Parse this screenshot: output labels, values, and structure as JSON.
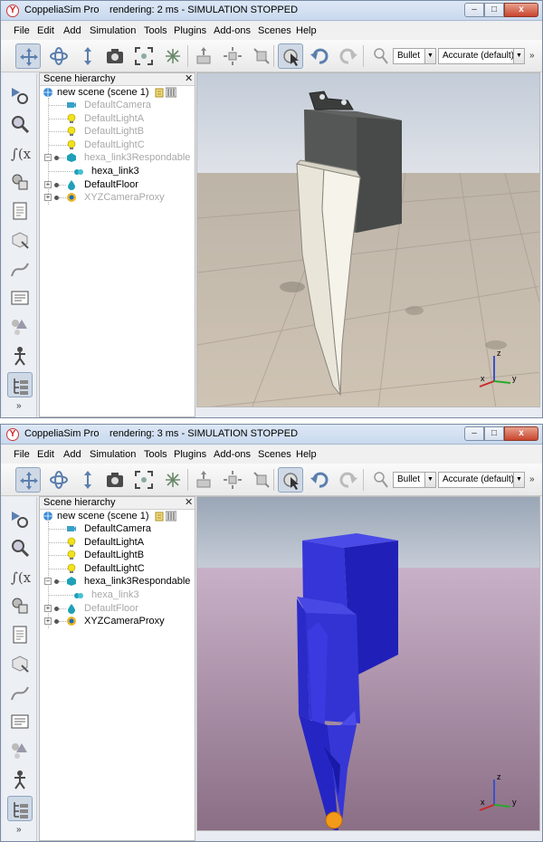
{
  "windows": [
    {
      "app_title": "CoppeliaSim Pro",
      "status": "rendering: 2 ms - SIMULATION STOPPED",
      "toolbar": {
        "physics_engine": "Bullet",
        "accuracy": "Accurate (default)"
      },
      "hierarchy": {
        "title": "Scene hierarchy",
        "scene": "new scene (scene 1)",
        "items": [
          {
            "label": "DefaultCamera",
            "dimmed": true
          },
          {
            "label": "DefaultLightA",
            "dimmed": true
          },
          {
            "label": "DefaultLightB",
            "dimmed": true
          },
          {
            "label": "DefaultLightC",
            "dimmed": true
          },
          {
            "label": "hexa_link3Respondable",
            "dimmed": true
          },
          {
            "label": "hexa_link3",
            "dimmed": false
          },
          {
            "label": "DefaultFloor",
            "dimmed": false
          },
          {
            "label": "XYZCameraProxy",
            "dimmed": true
          }
        ]
      },
      "viewport": {
        "theme": "textured-floor",
        "object_color": "#f2efe6"
      },
      "axes": {
        "x": "x",
        "y": "y",
        "z": "z"
      }
    },
    {
      "app_title": "CoppeliaSim Pro",
      "status": "rendering: 3 ms - SIMULATION STOPPED",
      "toolbar": {
        "physics_engine": "Bullet",
        "accuracy": "Accurate (default)"
      },
      "hierarchy": {
        "title": "Scene hierarchy",
        "scene": "new scene (scene 1)",
        "items": [
          {
            "label": "DefaultCamera",
            "dimmed": false
          },
          {
            "label": "DefaultLightA",
            "dimmed": false
          },
          {
            "label": "DefaultLightB",
            "dimmed": false
          },
          {
            "label": "DefaultLightC",
            "dimmed": false
          },
          {
            "label": "hexa_link3Respondable",
            "dimmed": false
          },
          {
            "label": "hexa_link3",
            "dimmed": true
          },
          {
            "label": "DefaultFloor",
            "dimmed": true
          },
          {
            "label": "XYZCameraProxy",
            "dimmed": false
          }
        ]
      },
      "viewport": {
        "theme": "pink-floor",
        "object_color": "#2f2fd6"
      },
      "axes": {
        "x": "x",
        "y": "y",
        "z": "z"
      }
    }
  ],
  "menu": [
    "File",
    "Edit",
    "Add",
    "Simulation",
    "Tools",
    "Plugins",
    "Add-ons",
    "Scenes",
    "Help"
  ],
  "window_buttons": {
    "minimize": "–",
    "maximize": "□",
    "close": "x"
  },
  "icons": {
    "toolbar": [
      "move-camera-icon",
      "rotate-camera-icon",
      "shift-camera-icon",
      "camera-angle-icon",
      "fit-to-view-icon",
      "fly-icon",
      "object-shift-icon",
      "object-rotate-icon",
      "object-move-icon",
      "select-cursor-icon",
      "undo-icon",
      "redo-icon",
      "physics-engine-icon"
    ],
    "left": [
      "simulation-settings-icon",
      "zoom-icon",
      "script-icon",
      "shape-edit-icon",
      "page-icon",
      "model-browser-icon",
      "path-icon",
      "layers-icon",
      "collection-icon",
      "scene-object-icon",
      "hierarchy-icon"
    ]
  }
}
